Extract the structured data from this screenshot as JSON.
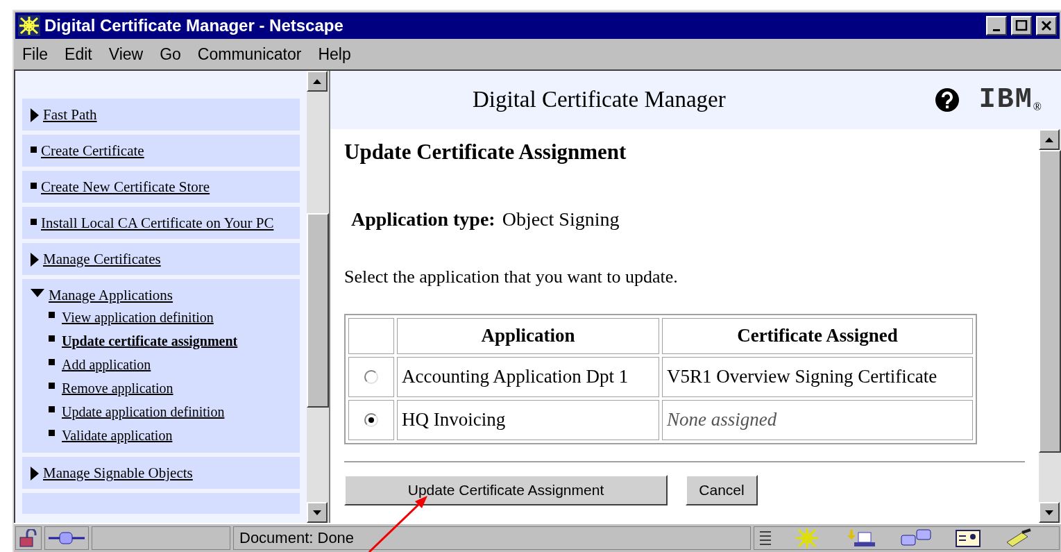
{
  "window": {
    "title": "Digital Certificate Manager - Netscape"
  },
  "menu": [
    {
      "label": "File"
    },
    {
      "label": "Edit"
    },
    {
      "label": "View"
    },
    {
      "label": "Go"
    },
    {
      "label": "Communicator"
    },
    {
      "label": "Help"
    }
  ],
  "sidebar": {
    "items": [
      {
        "kind": "section",
        "label": "Fast Path",
        "expanded": false
      },
      {
        "kind": "link",
        "label": "Create Certificate"
      },
      {
        "kind": "link",
        "label": "Create New Certificate Store"
      },
      {
        "kind": "link",
        "label": "Install Local CA Certificate on Your PC"
      },
      {
        "kind": "section",
        "label": "Manage Certificates",
        "expanded": false
      },
      {
        "kind": "section",
        "label": "Manage Applications",
        "expanded": true,
        "children": [
          {
            "label": "View application definition",
            "selected": false
          },
          {
            "label": "Update certificate assignment",
            "selected": true
          },
          {
            "label": "Add application",
            "selected": false
          },
          {
            "label": "Remove application",
            "selected": false
          },
          {
            "label": "Update application definition",
            "selected": false
          },
          {
            "label": "Validate application",
            "selected": false
          }
        ]
      },
      {
        "kind": "section",
        "label": "Manage Signable Objects",
        "expanded": false
      }
    ]
  },
  "header": {
    "title": "Digital Certificate Manager",
    "logo": "IBM",
    "logo_mark": "®"
  },
  "content": {
    "heading": "Update Certificate Assignment",
    "application_type": {
      "label": "Application type:",
      "value": "Object Signing"
    },
    "instruction": "Select the application that you want to update.",
    "table": {
      "columns": [
        "Application",
        "Certificate Assigned"
      ],
      "rows": [
        {
          "selected": false,
          "application": "Accounting Application Dpt 1",
          "certificate": "V5R1 Overview Signing Certificate",
          "assigned": true
        },
        {
          "selected": true,
          "application": "HQ Invoicing",
          "certificate": "None assigned",
          "assigned": false
        }
      ]
    },
    "buttons": [
      {
        "label": "Update Certificate Assignment"
      },
      {
        "label": "Cancel"
      }
    ]
  },
  "status_bar": {
    "text": "Document: Done"
  }
}
